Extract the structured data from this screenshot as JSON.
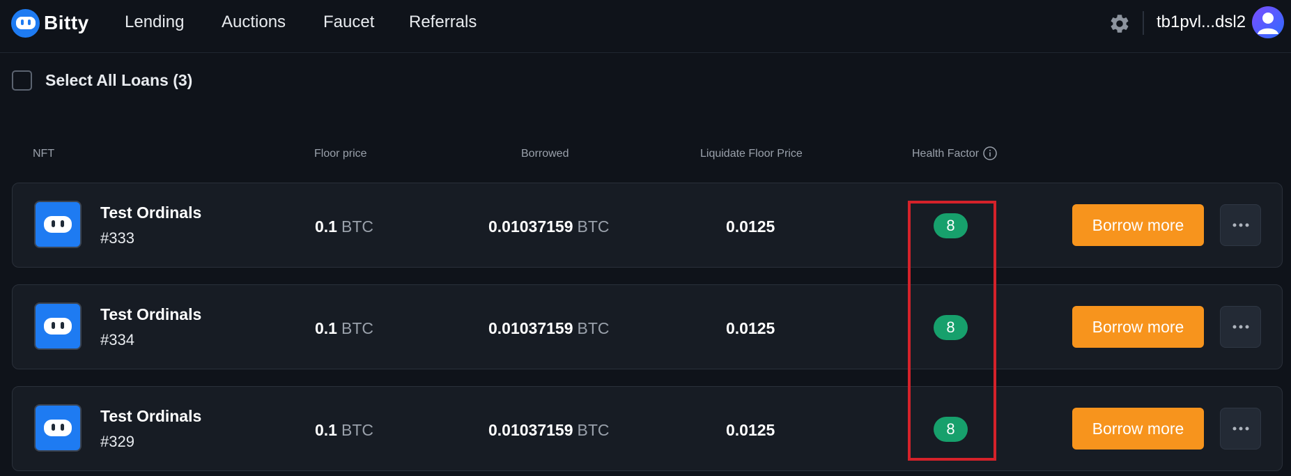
{
  "header": {
    "brand": "Bitty",
    "nav": [
      {
        "label": "Lending"
      },
      {
        "label": "Auctions"
      },
      {
        "label": "Faucet"
      },
      {
        "label": "Referrals"
      }
    ],
    "wallet": "tb1pvl...dsl2"
  },
  "select_all": {
    "label": "Select All Loans (3)"
  },
  "columns": {
    "nft": "NFT",
    "floor_price": "Floor price",
    "borrowed": "Borrowed",
    "liquidate": "Liquidate Floor Price",
    "health_factor": "Health Factor"
  },
  "loans": [
    {
      "name": "Test Ordinals",
      "id": "#333",
      "floor": "0.1",
      "floor_unit": "BTC",
      "borrowed": "0.01037159",
      "borrowed_unit": "BTC",
      "liquidate": "0.0125",
      "health": "8",
      "action": "Borrow more"
    },
    {
      "name": "Test Ordinals",
      "id": "#334",
      "floor": "0.1",
      "floor_unit": "BTC",
      "borrowed": "0.01037159",
      "borrowed_unit": "BTC",
      "liquidate": "0.0125",
      "health": "8",
      "action": "Borrow more"
    },
    {
      "name": "Test Ordinals",
      "id": "#329",
      "floor": "0.1",
      "floor_unit": "BTC",
      "borrowed": "0.01037159",
      "borrowed_unit": "BTC",
      "liquidate": "0.0125",
      "health": "8",
      "action": "Borrow more"
    }
  ],
  "colors": {
    "background": "#0f131a",
    "row_background": "#171c24",
    "brand_blue": "#1e7bf2",
    "action_orange": "#f7941d",
    "health_green": "#17a06c",
    "highlight_red": "#d5222a"
  },
  "icons": {
    "logo": "bitty-logo-icon",
    "settings": "gear-icon",
    "avatar": "user-avatar-icon",
    "info": "info-icon",
    "more": "ellipsis-icon"
  }
}
